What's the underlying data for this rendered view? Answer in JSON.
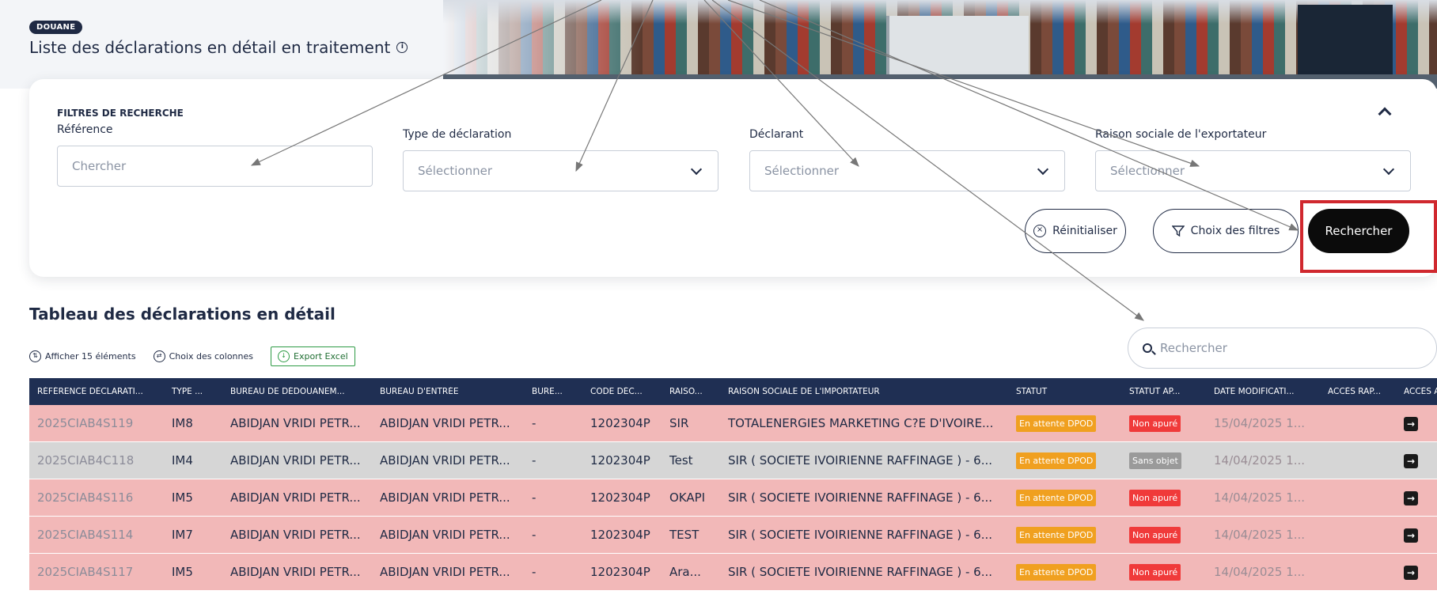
{
  "header": {
    "tag": "DOUANE",
    "title": "Liste des déclarations en détail en traitement",
    "info_icon": "info-icon"
  },
  "filters": {
    "heading": "FILTRES DE RECHERCHE",
    "reference": {
      "label": "Référence",
      "placeholder": "Chercher"
    },
    "type_declaration": {
      "label": "Type de déclaration",
      "value": "Sélectionner"
    },
    "declarant": {
      "label": "Déclarant",
      "value": "Sélectionner"
    },
    "exportateur": {
      "label": "Raison sociale de l'exportateur",
      "value": "Sélectionner"
    },
    "reset_label": "Réinitialiser",
    "choose_filters_label": "Choix des filtres",
    "search_label": "Rechercher"
  },
  "table": {
    "title": "Tableau des déclarations en détail",
    "show_label": "Afficher 15 éléments",
    "columns_label": "Choix des colonnes",
    "export_label": "Export Excel",
    "search_placeholder": "Rechercher",
    "headers": [
      "RÉFÉRENCE DÉCLARATI...",
      "TYPE ...",
      "BUREAU DE DÉDOUANEM...",
      "BUREAU D'ENTRÉE",
      "BURE...",
      "CODE DÉC...",
      "RAISO...",
      "RAISON SOCIALE DE L'IMPORTATEUR",
      "STATUT",
      "STATUT AP...",
      "DATE MODIFICATI...",
      "ACCÈS RAP...",
      "ACCÈS A"
    ],
    "rows": [
      {
        "ref": "2025CIAB4S119",
        "type": "IM8",
        "bureau_dedouanement": "ABIDJAN VRIDI PETR...",
        "bureau_entree": "ABIDJAN VRIDI PETR...",
        "bure": "-",
        "code": "1202304P",
        "raiso": "SIR",
        "importateur": "TOTALENERGIES MARKETING C?E D'IVOIRE...",
        "statut": "En attente DPOD",
        "statut_ap": "Non apuré",
        "date": "15/04/2025 1...",
        "color": "red",
        "statut_ap_style": "red"
      },
      {
        "ref": "2025CIAB4C118",
        "type": "IM4",
        "bureau_dedouanement": "ABIDJAN VRIDI PETR...",
        "bureau_entree": "ABIDJAN VRIDI PETR...",
        "bure": "-",
        "code": "1202304P",
        "raiso": "Test",
        "importateur": "SIR ( SOCIETE IVOIRIENNE RAFFINAGE ) - 6...",
        "statut": "En attente DPOD",
        "statut_ap": "Sans objet",
        "date": "14/04/2025 1...",
        "color": "grey",
        "statut_ap_style": "grey"
      },
      {
        "ref": "2025CIAB4S116",
        "type": "IM5",
        "bureau_dedouanement": "ABIDJAN VRIDI PETR...",
        "bureau_entree": "ABIDJAN VRIDI PETR...",
        "bure": "-",
        "code": "1202304P",
        "raiso": "OKAPI",
        "importateur": "SIR ( SOCIETE IVOIRIENNE RAFFINAGE ) - 6...",
        "statut": "En attente DPOD",
        "statut_ap": "Non apuré",
        "date": "14/04/2025 1...",
        "color": "red",
        "statut_ap_style": "red"
      },
      {
        "ref": "2025CIAB4S114",
        "type": "IM7",
        "bureau_dedouanement": "ABIDJAN VRIDI PETR...",
        "bureau_entree": "ABIDJAN VRIDI PETR...",
        "bure": "-",
        "code": "1202304P",
        "raiso": "TEST",
        "importateur": "SIR ( SOCIETE IVOIRIENNE RAFFINAGE ) - 6...",
        "statut": "En attente DPOD",
        "statut_ap": "Non apuré",
        "date": "14/04/2025 1...",
        "color": "red",
        "statut_ap_style": "red"
      },
      {
        "ref": "2025CIAB4S117",
        "type": "IM5",
        "bureau_dedouanement": "ABIDJAN VRIDI PETR...",
        "bureau_entree": "ABIDJAN VRIDI PETR...",
        "bure": "-",
        "code": "1202304P",
        "raiso": "Ara...",
        "importateur": "SIR ( SOCIETE IVOIRIENNE RAFFINAGE ) - 6...",
        "statut": "En attente DPOD",
        "statut_ap": "Non apuré",
        "date": "14/04/2025 1...",
        "color": "red",
        "statut_ap_style": "red"
      }
    ]
  },
  "colors": {
    "navy": "#1f2f53",
    "row_red": "#f2b8b8",
    "row_grey": "#d6d6d6",
    "badge_orange": "#f0a020",
    "badge_red": "#f03a3a",
    "highlight": "#d0282e"
  },
  "icons": {
    "reset": "circle-x-icon",
    "filters": "funnel-icon",
    "collapse": "chevron-up-icon",
    "dropdown": "chevron-down-icon",
    "show": "sort-icon",
    "columns": "columns-icon",
    "export": "download-icon",
    "search": "search-icon",
    "access": "arrow-right-square-icon"
  }
}
